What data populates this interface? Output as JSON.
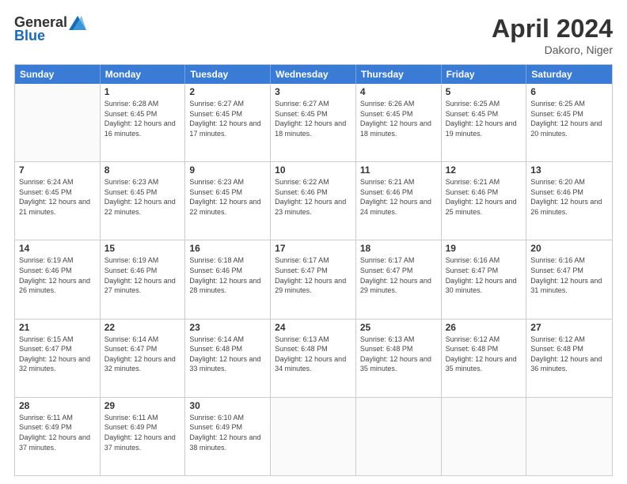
{
  "header": {
    "logo_general": "General",
    "logo_blue": "Blue",
    "title": "April 2024",
    "subtitle": "Dakoro, Niger"
  },
  "calendar": {
    "days_of_week": [
      "Sunday",
      "Monday",
      "Tuesday",
      "Wednesday",
      "Thursday",
      "Friday",
      "Saturday"
    ],
    "weeks": [
      [
        {
          "day": "",
          "empty": true
        },
        {
          "day": "1",
          "sunrise": "6:28 AM",
          "sunset": "6:45 PM",
          "daylight": "12 hours and 16 minutes."
        },
        {
          "day": "2",
          "sunrise": "6:27 AM",
          "sunset": "6:45 PM",
          "daylight": "12 hours and 17 minutes."
        },
        {
          "day": "3",
          "sunrise": "6:27 AM",
          "sunset": "6:45 PM",
          "daylight": "12 hours and 18 minutes."
        },
        {
          "day": "4",
          "sunrise": "6:26 AM",
          "sunset": "6:45 PM",
          "daylight": "12 hours and 18 minutes."
        },
        {
          "day": "5",
          "sunrise": "6:25 AM",
          "sunset": "6:45 PM",
          "daylight": "12 hours and 19 minutes."
        },
        {
          "day": "6",
          "sunrise": "6:25 AM",
          "sunset": "6:45 PM",
          "daylight": "12 hours and 20 minutes."
        }
      ],
      [
        {
          "day": "7",
          "sunrise": "6:24 AM",
          "sunset": "6:45 PM",
          "daylight": "12 hours and 21 minutes."
        },
        {
          "day": "8",
          "sunrise": "6:23 AM",
          "sunset": "6:45 PM",
          "daylight": "12 hours and 22 minutes."
        },
        {
          "day": "9",
          "sunrise": "6:23 AM",
          "sunset": "6:45 PM",
          "daylight": "12 hours and 22 minutes."
        },
        {
          "day": "10",
          "sunrise": "6:22 AM",
          "sunset": "6:46 PM",
          "daylight": "12 hours and 23 minutes."
        },
        {
          "day": "11",
          "sunrise": "6:21 AM",
          "sunset": "6:46 PM",
          "daylight": "12 hours and 24 minutes."
        },
        {
          "day": "12",
          "sunrise": "6:21 AM",
          "sunset": "6:46 PM",
          "daylight": "12 hours and 25 minutes."
        },
        {
          "day": "13",
          "sunrise": "6:20 AM",
          "sunset": "6:46 PM",
          "daylight": "12 hours and 26 minutes."
        }
      ],
      [
        {
          "day": "14",
          "sunrise": "6:19 AM",
          "sunset": "6:46 PM",
          "daylight": "12 hours and 26 minutes."
        },
        {
          "day": "15",
          "sunrise": "6:19 AM",
          "sunset": "6:46 PM",
          "daylight": "12 hours and 27 minutes."
        },
        {
          "day": "16",
          "sunrise": "6:18 AM",
          "sunset": "6:46 PM",
          "daylight": "12 hours and 28 minutes."
        },
        {
          "day": "17",
          "sunrise": "6:17 AM",
          "sunset": "6:47 PM",
          "daylight": "12 hours and 29 minutes."
        },
        {
          "day": "18",
          "sunrise": "6:17 AM",
          "sunset": "6:47 PM",
          "daylight": "12 hours and 29 minutes."
        },
        {
          "day": "19",
          "sunrise": "6:16 AM",
          "sunset": "6:47 PM",
          "daylight": "12 hours and 30 minutes."
        },
        {
          "day": "20",
          "sunrise": "6:16 AM",
          "sunset": "6:47 PM",
          "daylight": "12 hours and 31 minutes."
        }
      ],
      [
        {
          "day": "21",
          "sunrise": "6:15 AM",
          "sunset": "6:47 PM",
          "daylight": "12 hours and 32 minutes."
        },
        {
          "day": "22",
          "sunrise": "6:14 AM",
          "sunset": "6:47 PM",
          "daylight": "12 hours and 32 minutes."
        },
        {
          "day": "23",
          "sunrise": "6:14 AM",
          "sunset": "6:48 PM",
          "daylight": "12 hours and 33 minutes."
        },
        {
          "day": "24",
          "sunrise": "6:13 AM",
          "sunset": "6:48 PM",
          "daylight": "12 hours and 34 minutes."
        },
        {
          "day": "25",
          "sunrise": "6:13 AM",
          "sunset": "6:48 PM",
          "daylight": "12 hours and 35 minutes."
        },
        {
          "day": "26",
          "sunrise": "6:12 AM",
          "sunset": "6:48 PM",
          "daylight": "12 hours and 35 minutes."
        },
        {
          "day": "27",
          "sunrise": "6:12 AM",
          "sunset": "6:48 PM",
          "daylight": "12 hours and 36 minutes."
        }
      ],
      [
        {
          "day": "28",
          "sunrise": "6:11 AM",
          "sunset": "6:49 PM",
          "daylight": "12 hours and 37 minutes."
        },
        {
          "day": "29",
          "sunrise": "6:11 AM",
          "sunset": "6:49 PM",
          "daylight": "12 hours and 37 minutes."
        },
        {
          "day": "30",
          "sunrise": "6:10 AM",
          "sunset": "6:49 PM",
          "daylight": "12 hours and 38 minutes."
        },
        {
          "day": "",
          "empty": true
        },
        {
          "day": "",
          "empty": true
        },
        {
          "day": "",
          "empty": true
        },
        {
          "day": "",
          "empty": true
        }
      ]
    ]
  }
}
